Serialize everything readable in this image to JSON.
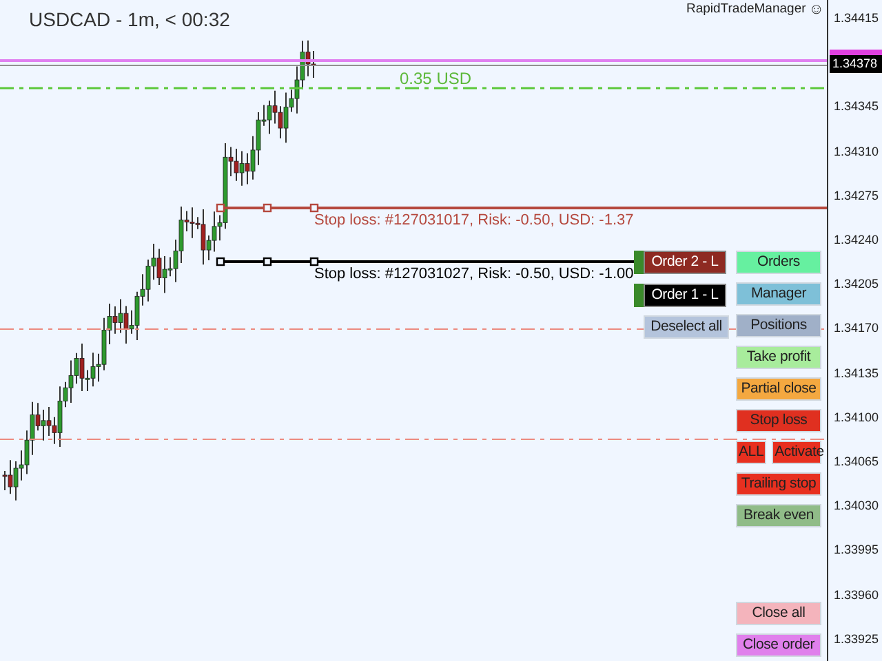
{
  "chart": {
    "title": "USDCAD - 1m, < 00:32",
    "indicator": "RapidTradeManager",
    "indicator_icon": "☺",
    "profit_label": "0.35 USD",
    "current_price": "1.34378",
    "price_axis": [
      "1.34415",
      "1.34345",
      "1.34310",
      "1.34275",
      "1.34240",
      "1.34205",
      "1.34170",
      "1.34135",
      "1.34100",
      "1.34065",
      "1.34030",
      "1.33995",
      "1.33960",
      "1.33925"
    ],
    "stop_lines": [
      {
        "label": "Stop loss: #127031017, Risk: -0.50,  USD: -1.37",
        "color": "#b5483e"
      },
      {
        "label": "Stop loss: #127031027, Risk: -0.50,  USD: -1.00",
        "color": "#000000"
      }
    ]
  },
  "order_buttons": [
    {
      "label": "Order 2 - L",
      "color": "#8e2a22"
    },
    {
      "label": "Order 1 - L",
      "color": "#000000"
    }
  ],
  "deselect_button": "Deselect all",
  "panel_rows": [
    {
      "buttons": [
        {
          "label": "Orders",
          "color": "#66f0a0"
        }
      ]
    },
    {
      "buttons": [
        {
          "label": "Manager",
          "color": "#7ec0d8"
        }
      ]
    },
    {
      "buttons": [
        {
          "label": "Positions",
          "color": "#a0b0c8"
        }
      ]
    },
    {
      "buttons": [
        {
          "label": "Take profit",
          "color": "#a8ec9c"
        }
      ]
    },
    {
      "buttons": [
        {
          "label": "Partial close",
          "color": "#f4a840"
        }
      ]
    },
    {
      "buttons": [
        {
          "label": "Stop loss",
          "color": "#e03020"
        }
      ]
    },
    {
      "buttons": [
        {
          "label": "ALL",
          "color": "#e83020"
        },
        {
          "label": "Activate",
          "color": "#e83020"
        }
      ]
    },
    {
      "buttons": [
        {
          "label": "Trailing stop",
          "color": "#e83020"
        }
      ]
    },
    {
      "buttons": [
        {
          "label": "Break even",
          "color": "#90bc88"
        }
      ]
    }
  ],
  "panel_bottom": [
    {
      "label": "Close all",
      "color": "#f4b4bc"
    },
    {
      "label": "Close order",
      "color": "#e080ec"
    }
  ]
}
